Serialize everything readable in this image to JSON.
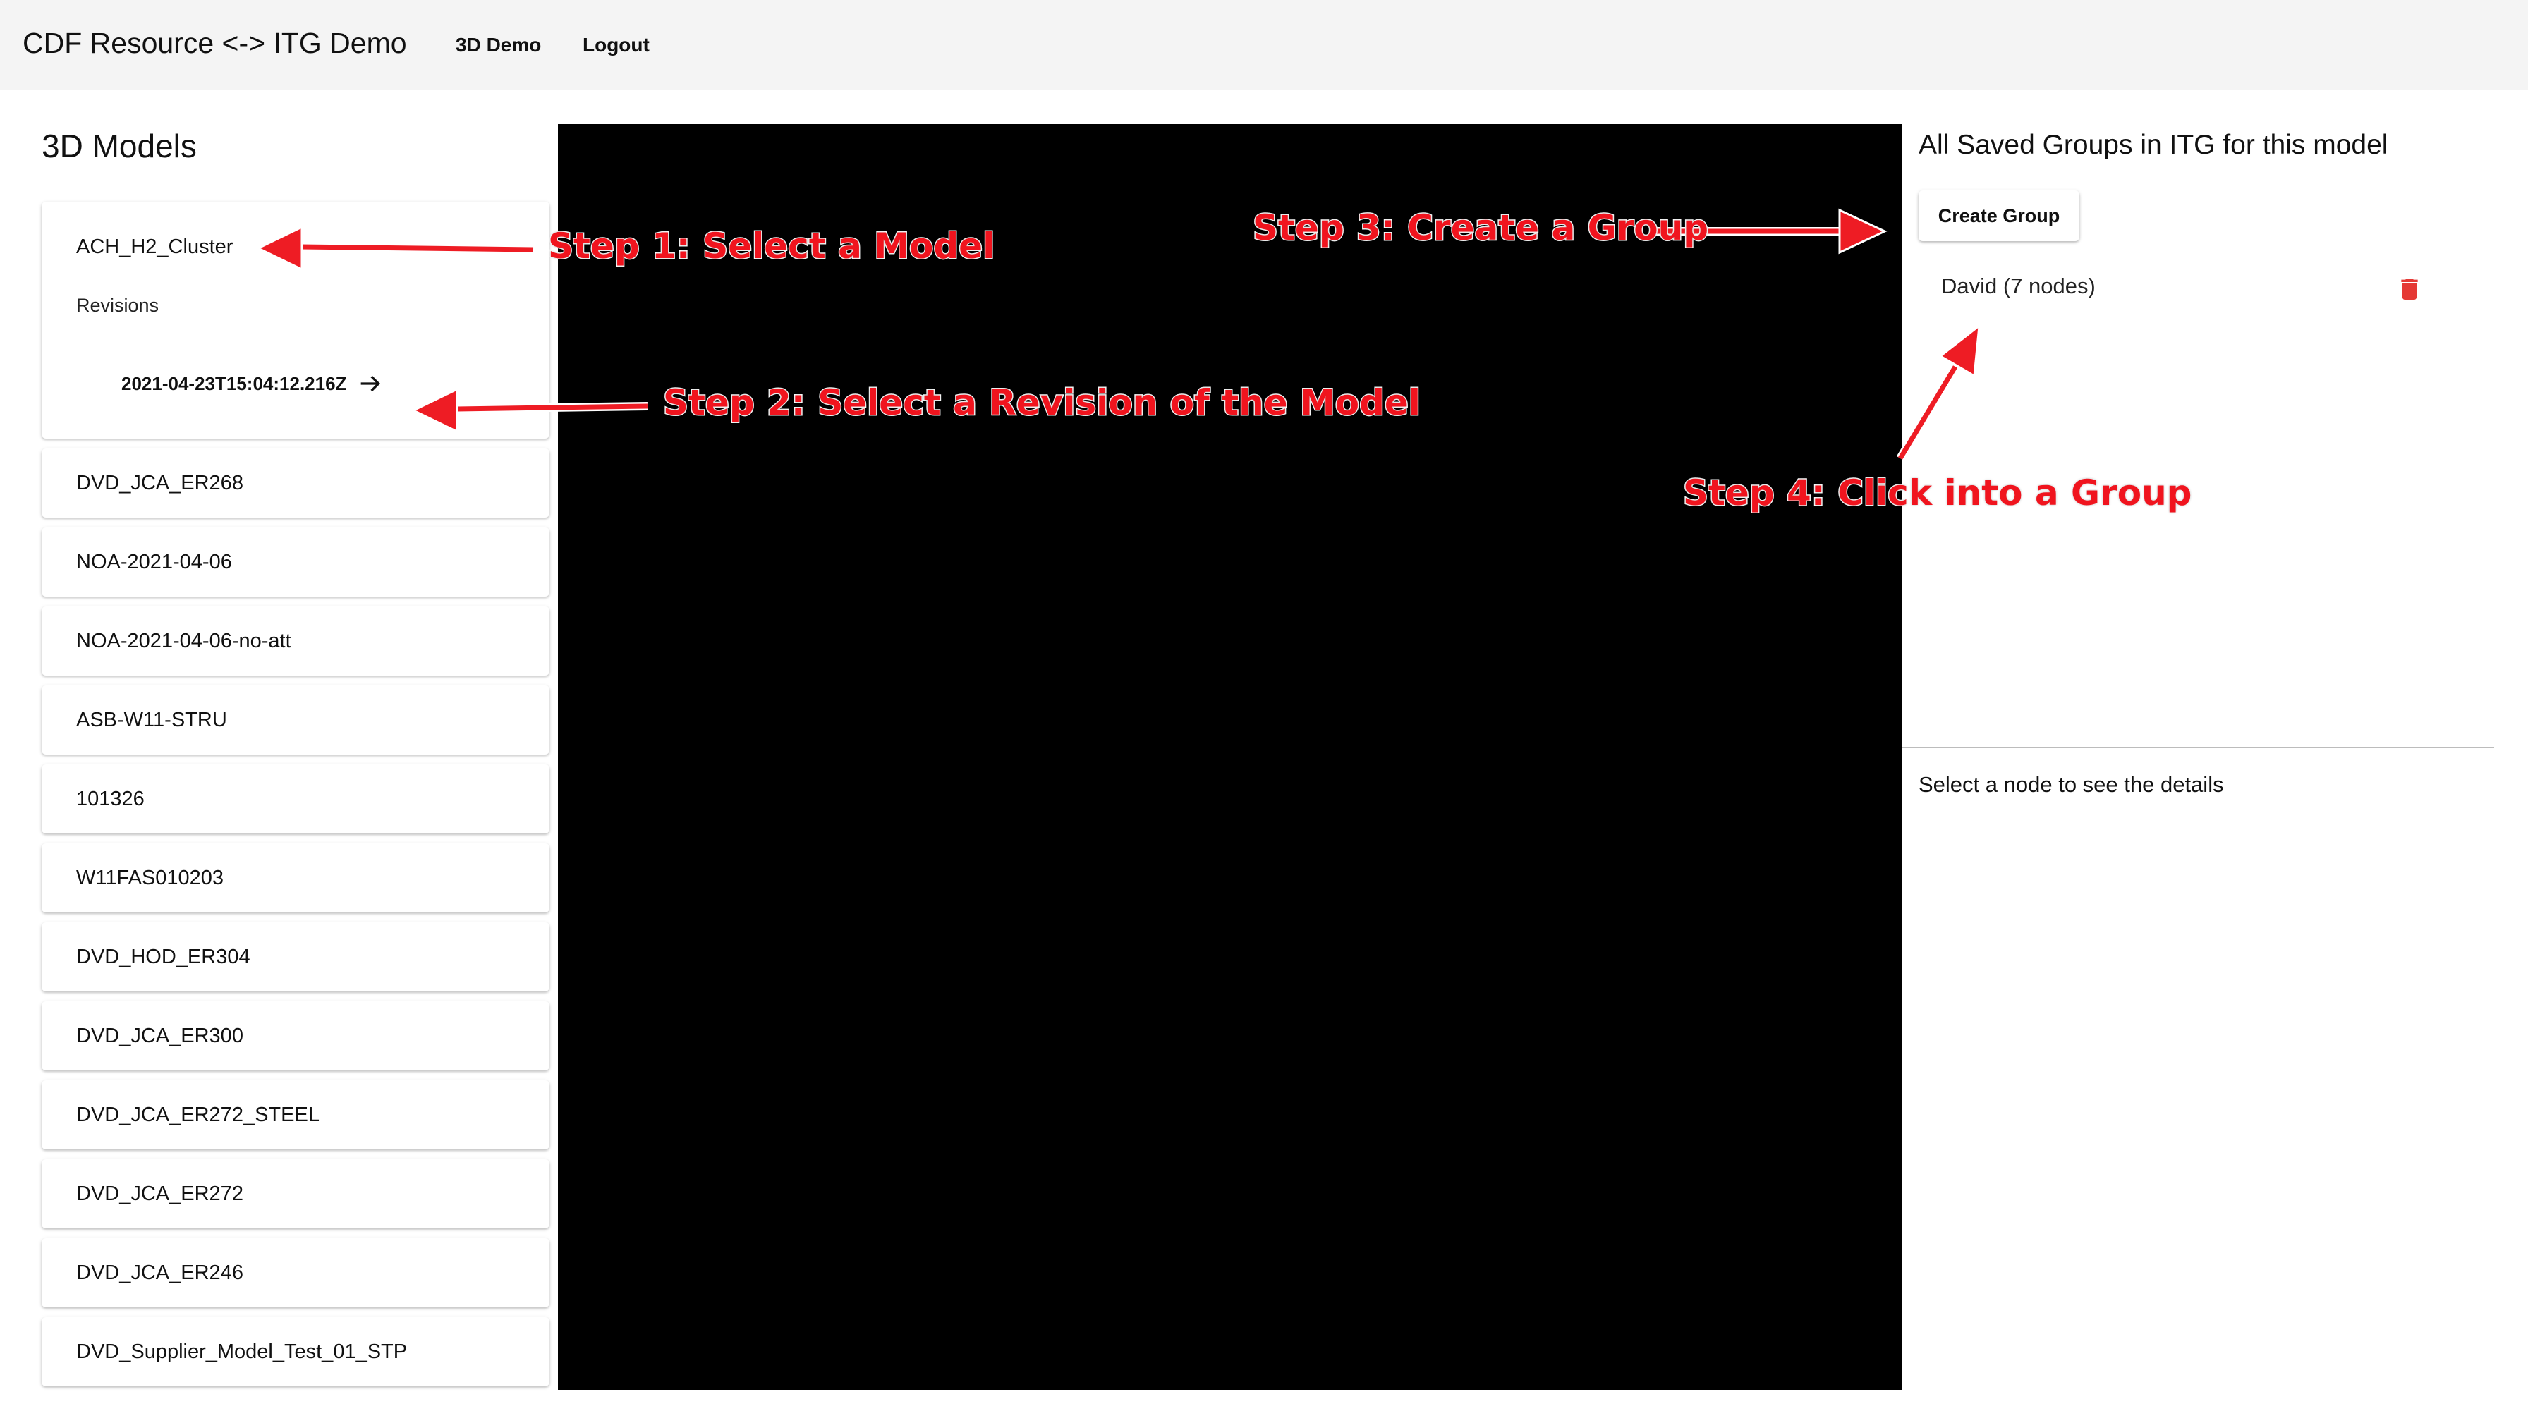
{
  "app": {
    "title": "CDF Resource <-> ITG Demo",
    "nav": {
      "demo_label": "3D Demo",
      "logout_label": "Logout"
    }
  },
  "models_panel": {
    "heading": "3D Models",
    "selected_model": {
      "name": "ACH_H2_Cluster",
      "revisions_label": "Revisions",
      "revision": "2021-04-23T15:04:12.216Z"
    },
    "models": [
      "DVD_JCA_ER268",
      "NOA-2021-04-06",
      "NOA-2021-04-06-no-att",
      "ASB-W11-STRU",
      "101326",
      "W11FAS010203",
      "DVD_HOD_ER304",
      "DVD_JCA_ER300",
      "DVD_JCA_ER272_STEEL",
      "DVD_JCA_ER272",
      "DVD_JCA_ER246",
      "DVD_Supplier_Model_Test_01_STP"
    ]
  },
  "groups_panel": {
    "heading": "All Saved Groups in ITG for this model",
    "create_label": "Create Group",
    "groups": [
      {
        "label": "David (7 nodes)"
      }
    ],
    "details_placeholder": "Select a node to see the details"
  },
  "annotations": {
    "step1": "Step 1: Select a Model",
    "step2": "Step 2: Select a Revision of the Model",
    "step3": "Step 3: Create a Group",
    "step4": "Step 4: Click into a Group"
  },
  "colors": {
    "appbar_bg": "#f4f4f4",
    "viewer_bg": "#000000",
    "annotation_red": "#f0141e",
    "trash_icon": "#e53935"
  },
  "icons": {
    "revision_arrow": "arrow-right-icon",
    "group_delete": "trash-icon"
  }
}
